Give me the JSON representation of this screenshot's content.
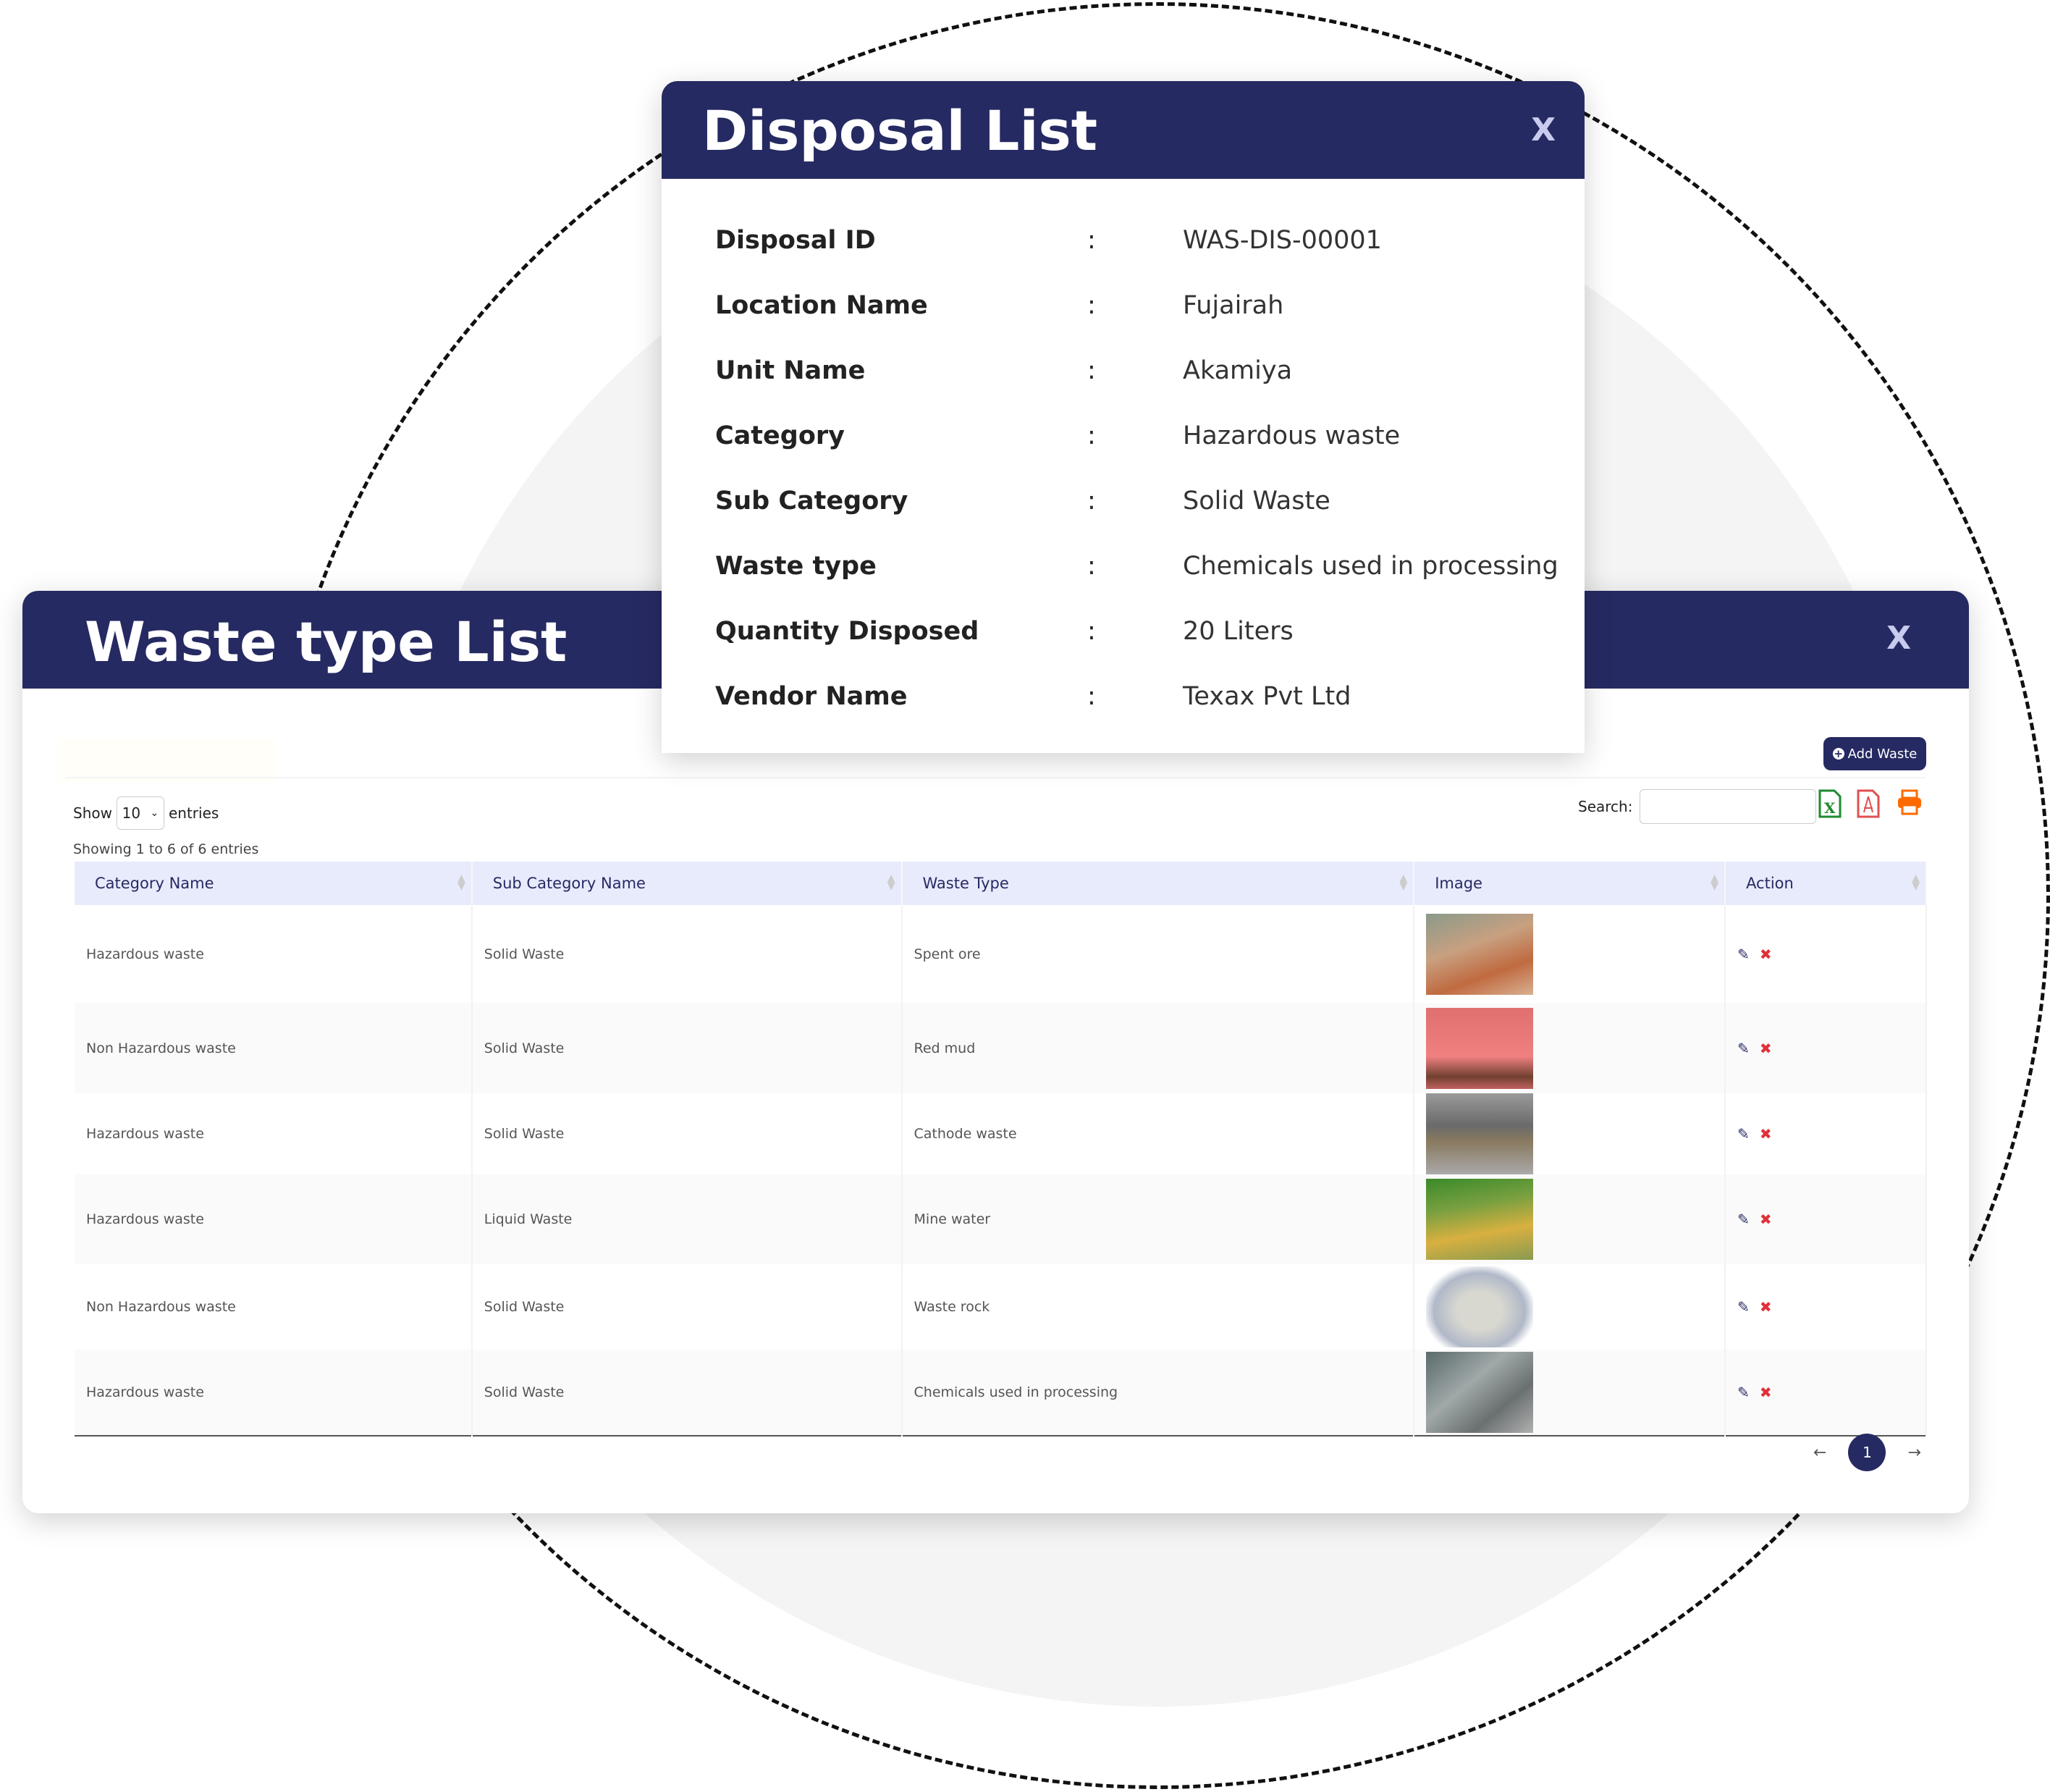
{
  "colors": {
    "primary": "#262a62",
    "header_bg": "#e8ebfc",
    "delete": "#e0303a",
    "excel": "#1e8a2e",
    "pdf": "#e05050",
    "print": "#ff6a00"
  },
  "disposal": {
    "title": "Disposal List",
    "close": "X",
    "rows": [
      {
        "label": "Disposal ID",
        "sep": ":",
        "value": "WAS-DIS-00001"
      },
      {
        "label": "Location Name",
        "sep": ":",
        "value": "Fujairah"
      },
      {
        "label": "Unit Name",
        "sep": ":",
        "value": "Akamiya"
      },
      {
        "label": "Category",
        "sep": ":",
        "value": "Hazardous waste"
      },
      {
        "label": "Sub Category",
        "sep": ":",
        "value": "Solid Waste"
      },
      {
        "label": "Waste type",
        "sep": ":",
        "value": "Chemicals used in processing"
      },
      {
        "label": "Quantity Disposed",
        "sep": ":",
        "value": "20 Liters"
      },
      {
        "label": "Vendor Name",
        "sep": ":",
        "value": "Texax Pvt Ltd"
      }
    ]
  },
  "waste": {
    "title": "Waste type List",
    "close": "X",
    "add_label": "Add Waste",
    "show_label": "Show",
    "entries_value": "10",
    "entries_label": "entries",
    "search_label": "Search:",
    "search_value": "",
    "info": "Showing 1 to 6 of 6 entries",
    "columns": [
      "Category Name",
      "Sub Category Name",
      "Waste Type",
      "Image",
      "Action"
    ],
    "rows": [
      {
        "category": "Hazardous waste",
        "sub": "Solid Waste",
        "type": "Spent ore"
      },
      {
        "category": "Non Hazardous waste",
        "sub": "Solid Waste",
        "type": "Red mud"
      },
      {
        "category": "Hazardous waste",
        "sub": "Solid Waste",
        "type": "Cathode waste"
      },
      {
        "category": "Hazardous waste",
        "sub": "Liquid Waste",
        "type": "Mine water"
      },
      {
        "category": "Non Hazardous waste",
        "sub": "Solid Waste",
        "type": "Waste rock"
      },
      {
        "category": "Hazardous waste",
        "sub": "Solid Waste",
        "type": "Chemicals used in processing"
      }
    ],
    "page": "1",
    "icons": [
      "excel-icon",
      "pdf-icon",
      "print-icon",
      "edit-icon",
      "delete-icon"
    ]
  }
}
